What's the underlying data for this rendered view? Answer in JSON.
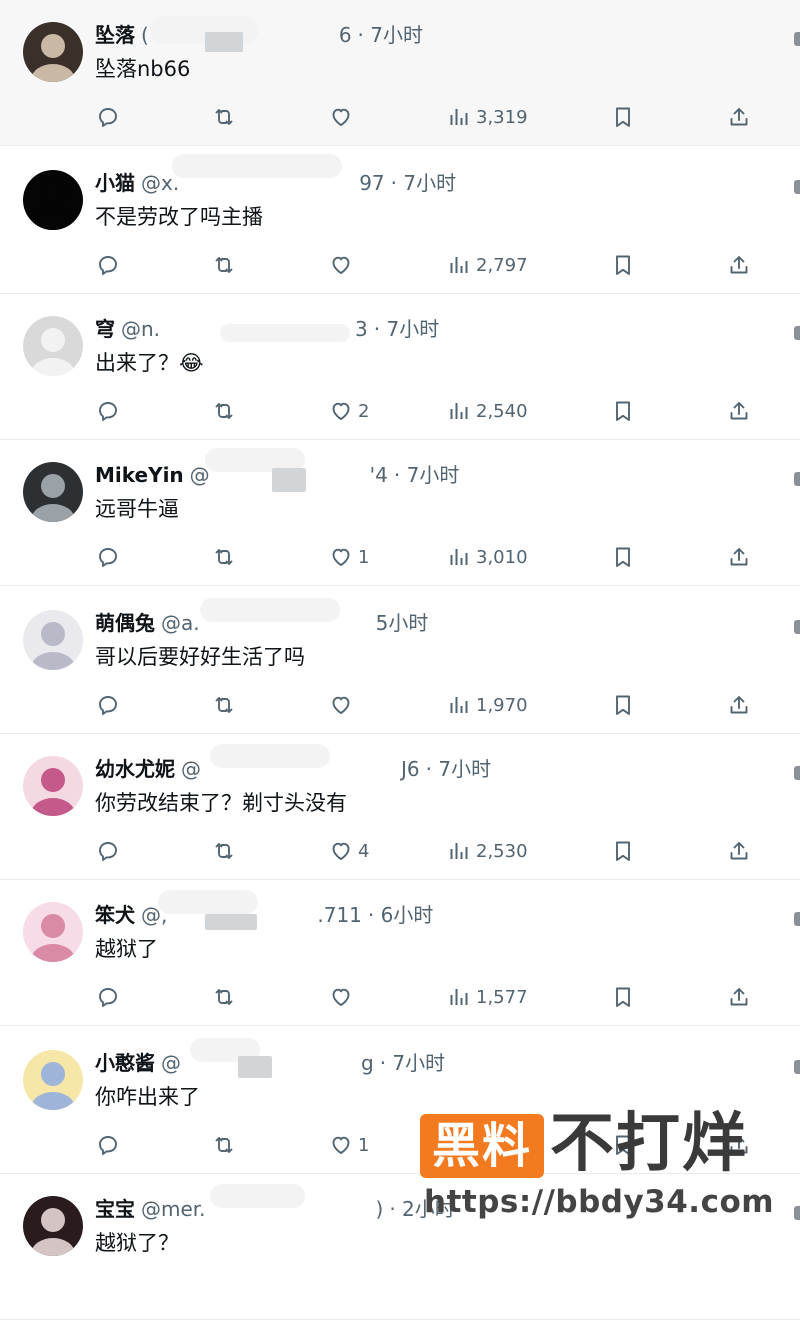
{
  "replies": [
    {
      "name": "坠落",
      "handle": "(",
      "handle_tail": "6",
      "time": "· 7小时",
      "text": "坠落nb66",
      "stats": {
        "replies": "",
        "retweets": "",
        "likes": "",
        "views": "3,319"
      }
    },
    {
      "name": "小猫",
      "handle": "@x.",
      "handle_tail": "97",
      "time": "· 7小时",
      "text": "不是劳改了吗主播",
      "stats": {
        "replies": "",
        "retweets": "",
        "likes": "",
        "views": "2,797"
      }
    },
    {
      "name": "穹",
      "handle": "@n.",
      "handle_tail": "3",
      "time": "· 7小时",
      "text": "出来了？😂",
      "stats": {
        "replies": "",
        "retweets": "",
        "likes": "2",
        "views": "2,540"
      }
    },
    {
      "name": "MikeYin",
      "handle": "@",
      "handle_tail": "'4",
      "time": "· 7小时",
      "text": "远哥牛逼",
      "stats": {
        "replies": "",
        "retweets": "",
        "likes": "1",
        "views": "3,010"
      }
    },
    {
      "name": "萌偶兔",
      "handle": "@a.",
      "handle_tail": "",
      "time": "5小时",
      "text": "哥以后要好好生活了吗",
      "stats": {
        "replies": "",
        "retweets": "",
        "likes": "",
        "views": "1,970"
      }
    },
    {
      "name": "幼水尤妮",
      "handle": "@",
      "handle_tail": "J6",
      "time": "· 7小时",
      "text": "你劳改结束了？剃寸头没有",
      "stats": {
        "replies": "",
        "retweets": "",
        "likes": "4",
        "views": "2,530"
      }
    },
    {
      "name": "笨犬",
      "handle": "@,",
      "handle_tail": ".711",
      "time": "· 6小时",
      "text": "越狱了",
      "stats": {
        "replies": "",
        "retweets": "",
        "likes": "",
        "views": "1,577"
      }
    },
    {
      "name": "小憨酱",
      "handle": "@",
      "handle_tail": "g",
      "time": "· 7小时",
      "text": "你咋出来了",
      "stats": {
        "replies": "",
        "retweets": "",
        "likes": "1",
        "views": "2,526"
      }
    },
    {
      "name": "宝宝",
      "handle": "@mer.",
      "handle_tail": ")",
      "time": "· 2小时",
      "text": "越狱了？",
      "stats": {
        "replies": "",
        "retweets": "",
        "likes": "",
        "views": ""
      }
    }
  ],
  "watermark": {
    "badge": "黑料",
    "title": "不打烊",
    "url": "https://bbdy34.com"
  },
  "icons": {
    "reply": "reply-icon",
    "retweet": "retweet-icon",
    "like": "heart-icon",
    "views": "views-chart-icon",
    "bookmark": "bookmark-icon",
    "share": "share-icon"
  },
  "colors": {
    "icon_gray": "#536471",
    "watermark_orange": "#f47a20"
  }
}
